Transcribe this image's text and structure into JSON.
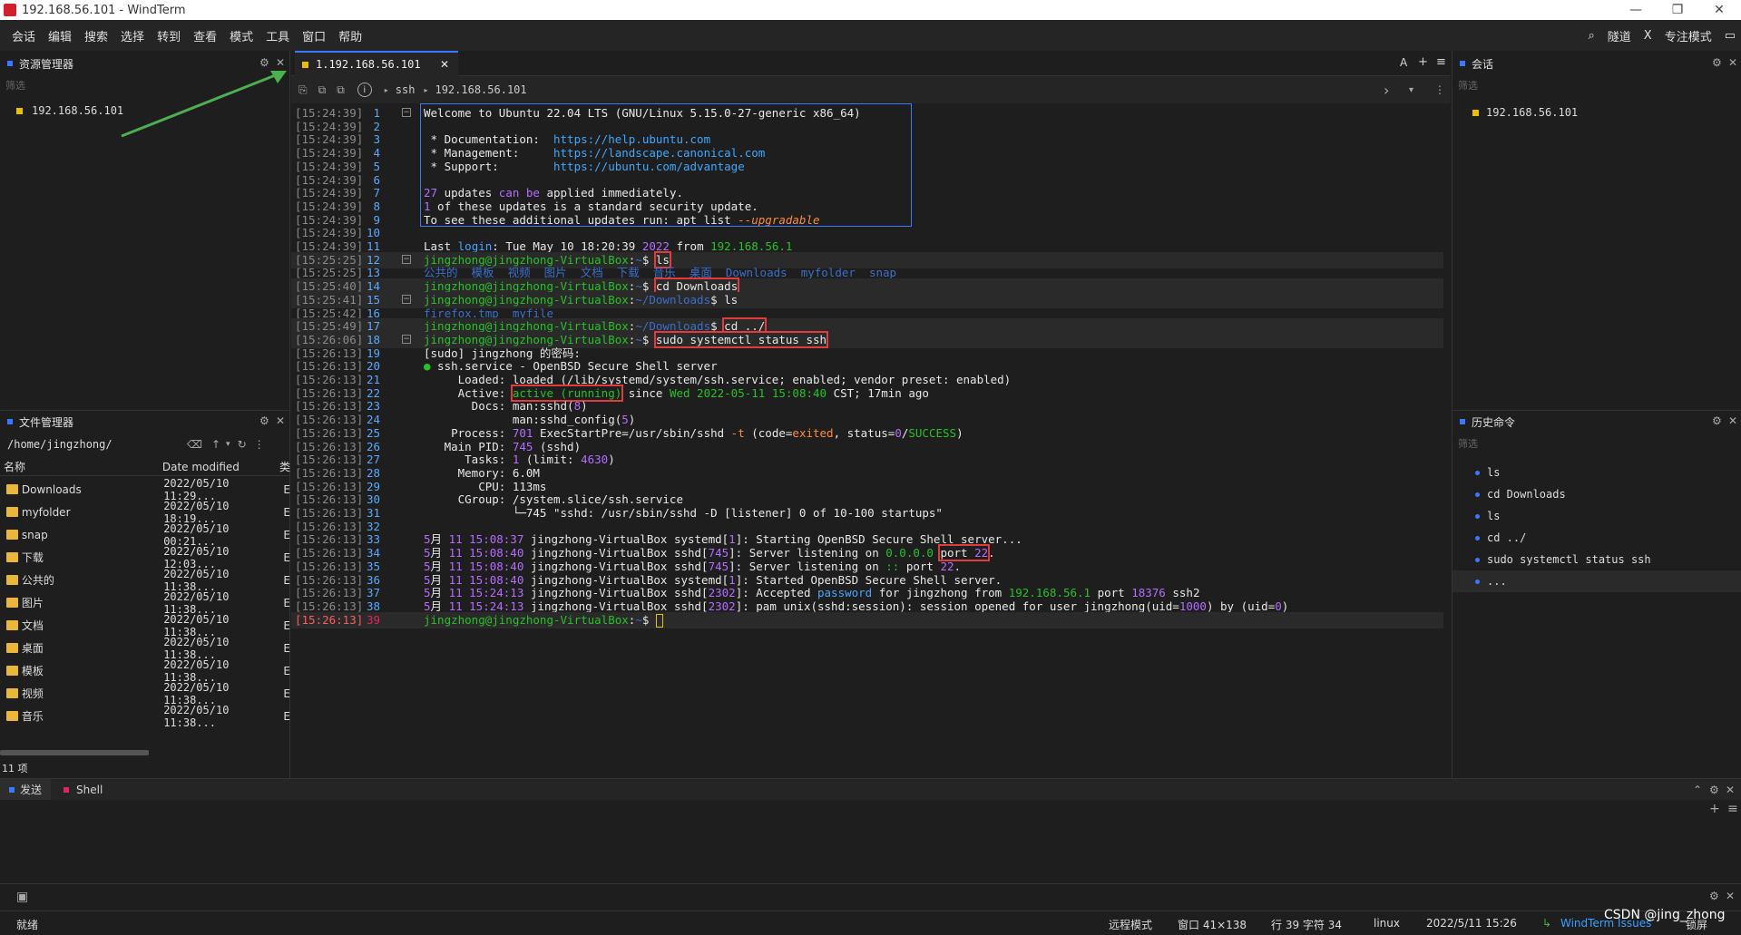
{
  "window": {
    "title": "192.168.56.101 - WindTerm",
    "min": "—",
    "max": "❐",
    "close": "✕"
  },
  "menu": [
    "会话",
    "编辑",
    "搜索",
    "选择",
    "转到",
    "查看",
    "模式",
    "工具",
    "窗口",
    "帮助"
  ],
  "menu_right": {
    "search": "⌕",
    "tunnel": "隧道",
    "x": "X",
    "focus": "专注模式",
    "layout": "▭"
  },
  "explorer": {
    "title": "资源管理器",
    "filter": "筛选",
    "item": "192.168.56.101"
  },
  "filemgr": {
    "title": "文件管理器",
    "path": "/home/jingzhong/",
    "col_name": "名称",
    "col_date": "Date modified",
    "col_extra": "类",
    "rows": [
      {
        "name": "Downloads",
        "date": "2022/05/10 11:29..."
      },
      {
        "name": "myfolder",
        "date": "2022/05/10 18:19..."
      },
      {
        "name": "snap",
        "date": "2022/05/10 00:21..."
      },
      {
        "name": "下载",
        "date": "2022/05/10 12:03..."
      },
      {
        "name": "公共的",
        "date": "2022/05/10 11:38..."
      },
      {
        "name": "图片",
        "date": "2022/05/10 11:38..."
      },
      {
        "name": "文档",
        "date": "2022/05/10 11:38..."
      },
      {
        "name": "桌面",
        "date": "2022/05/10 11:38..."
      },
      {
        "name": "模板",
        "date": "2022/05/10 11:38..."
      },
      {
        "name": "视频",
        "date": "2022/05/10 11:38..."
      },
      {
        "name": "音乐",
        "date": "2022/05/10 11:38..."
      }
    ],
    "count": "11 项",
    "row_suffix": "E"
  },
  "tab": {
    "label": "1.192.168.56.101",
    "close": "✕",
    "right": [
      "A",
      "+",
      "≡"
    ]
  },
  "addr": {
    "proto": "ssh",
    "host": "192.168.56.101"
  },
  "terminal": {
    "lines": [
      {
        "ts": "[15:24:39]",
        "n": "1",
        "t": "Welcome to Ubuntu 22.04 LTS (GNU/Linux 5.15.0-27-generic x86_64)"
      },
      {
        "ts": "[15:24:39]",
        "n": "2",
        "t": ""
      },
      {
        "ts": "[15:24:39]",
        "n": "3",
        "t": " * Documentation:  https://help.ubuntu.com"
      },
      {
        "ts": "[15:24:39]",
        "n": "4",
        "t": " * Management:     https://landscape.canonical.com"
      },
      {
        "ts": "[15:24:39]",
        "n": "5",
        "t": " * Support:        https://ubuntu.com/advantage"
      },
      {
        "ts": "[15:24:39]",
        "n": "6",
        "t": ""
      },
      {
        "ts": "[15:24:39]",
        "n": "7",
        "t": "27 updates can be applied immediately."
      },
      {
        "ts": "[15:24:39]",
        "n": "8",
        "t": "1 of these updates is a standard security update."
      },
      {
        "ts": "[15:24:39]",
        "n": "9",
        "t": "To see these additional updates run: apt list --upgradable"
      },
      {
        "ts": "[15:24:39]",
        "n": "10",
        "t": ""
      },
      {
        "ts": "[15:24:39]",
        "n": "11",
        "t": "Last login: Tue May 10 18:20:39 2022 from 192.168.56.1"
      },
      {
        "ts": "[15:25:25]",
        "n": "12",
        "t": "jingzhong@jingzhong-VirtualBox:~$ ls"
      },
      {
        "ts": "[15:25:25]",
        "n": "13",
        "t": "公共的  模板  视频  图片  文档  下载  音乐  桌面  Downloads  myfolder  snap"
      },
      {
        "ts": "[15:25:40]",
        "n": "14",
        "t": "jingzhong@jingzhong-VirtualBox:~$ cd Downloads"
      },
      {
        "ts": "[15:25:41]",
        "n": "15",
        "t": "jingzhong@jingzhong-VirtualBox:~/Downloads$ ls"
      },
      {
        "ts": "[15:25:42]",
        "n": "16",
        "t": "firefox.tmp  myfile"
      },
      {
        "ts": "[15:25:49]",
        "n": "17",
        "t": "jingzhong@jingzhong-VirtualBox:~/Downloads$ cd ../"
      },
      {
        "ts": "[15:26:06]",
        "n": "18",
        "t": "jingzhong@jingzhong-VirtualBox:~$ sudo systemctl status ssh"
      },
      {
        "ts": "[15:26:13]",
        "n": "19",
        "t": "[sudo] jingzhong 的密码:"
      },
      {
        "ts": "[15:26:13]",
        "n": "20",
        "t": "● ssh.service - OpenBSD Secure Shell server"
      },
      {
        "ts": "[15:26:13]",
        "n": "21",
        "t": "     Loaded: loaded (/lib/systemd/system/ssh.service; enabled; vendor preset: enabled)"
      },
      {
        "ts": "[15:26:13]",
        "n": "22",
        "t": "     Active: active (running) since Wed 2022-05-11 15:08:40 CST; 17min ago"
      },
      {
        "ts": "[15:26:13]",
        "n": "23",
        "t": "       Docs: man:sshd(8)"
      },
      {
        "ts": "[15:26:13]",
        "n": "24",
        "t": "             man:sshd_config(5)"
      },
      {
        "ts": "[15:26:13]",
        "n": "25",
        "t": "    Process: 701 ExecStartPre=/usr/sbin/sshd -t (code=exited, status=0/SUCCESS)"
      },
      {
        "ts": "[15:26:13]",
        "n": "26",
        "t": "   Main PID: 745 (sshd)"
      },
      {
        "ts": "[15:26:13]",
        "n": "27",
        "t": "      Tasks: 1 (limit: 4630)"
      },
      {
        "ts": "[15:26:13]",
        "n": "28",
        "t": "     Memory: 6.0M"
      },
      {
        "ts": "[15:26:13]",
        "n": "29",
        "t": "        CPU: 113ms"
      },
      {
        "ts": "[15:26:13]",
        "n": "30",
        "t": "     CGroup: /system.slice/ssh.service"
      },
      {
        "ts": "[15:26:13]",
        "n": "31",
        "t": "             └─745 \"sshd: /usr/sbin/sshd -D [listener] 0 of 10-100 startups\""
      },
      {
        "ts": "[15:26:13]",
        "n": "32",
        "t": ""
      },
      {
        "ts": "[15:26:13]",
        "n": "33",
        "t": "5月 11 15:08:37 jingzhong-VirtualBox systemd[1]: Starting OpenBSD Secure Shell server..."
      },
      {
        "ts": "[15:26:13]",
        "n": "34",
        "t": "5月 11 15:08:40 jingzhong-VirtualBox sshd[745]: Server listening on 0.0.0.0 port 22."
      },
      {
        "ts": "[15:26:13]",
        "n": "35",
        "t": "5月 11 15:08:40 jingzhong-VirtualBox sshd[745]: Server listening on :: port 22."
      },
      {
        "ts": "[15:26:13]",
        "n": "36",
        "t": "5月 11 15:08:40 jingzhong-VirtualBox systemd[1]: Started OpenBSD Secure Shell server."
      },
      {
        "ts": "[15:26:13]",
        "n": "37",
        "t": "5月 11 15:24:13 jingzhong-VirtualBox sshd[2302]: Accepted password for jingzhong from 192.168.56.1 port 18376 ssh2"
      },
      {
        "ts": "[15:26:13]",
        "n": "38",
        "t": "5月 11 15:24:13 jingzhong-VirtualBox sshd[2302]: pam_unix(sshd:session): session opened for user jingzhong(uid=1000) by (uid=0)"
      },
      {
        "ts": "[15:26:13]",
        "n": "39",
        "t": "jingzhong@jingzhong-VirtualBox:~$ "
      }
    ]
  },
  "sessions": {
    "title": "会话",
    "filter": "筛选",
    "item": "192.168.56.101"
  },
  "history": {
    "title": "历史命令",
    "filter": "筛选",
    "items": [
      "ls",
      "cd Downloads",
      "ls",
      "cd ../",
      "sudo systemctl status ssh",
      "..."
    ]
  },
  "bottom": {
    "send": "发送",
    "shell": "Shell"
  },
  "status": {
    "ready": "就绪",
    "mode": "远程模式",
    "window": "窗口 41×138",
    "pos": "行 39 字符 34",
    "os": "linux",
    "datetime": "2022/5/11 15:26",
    "issues": "WindTerm Issues",
    "lock": "锁屏",
    "watermark": "CSDN @jing_zhong"
  },
  "colors": {
    "accent": "#3a78ff",
    "prompt": "#27c227",
    "highlight_box": "#e23b3b",
    "folder": "#e9b73b"
  }
}
